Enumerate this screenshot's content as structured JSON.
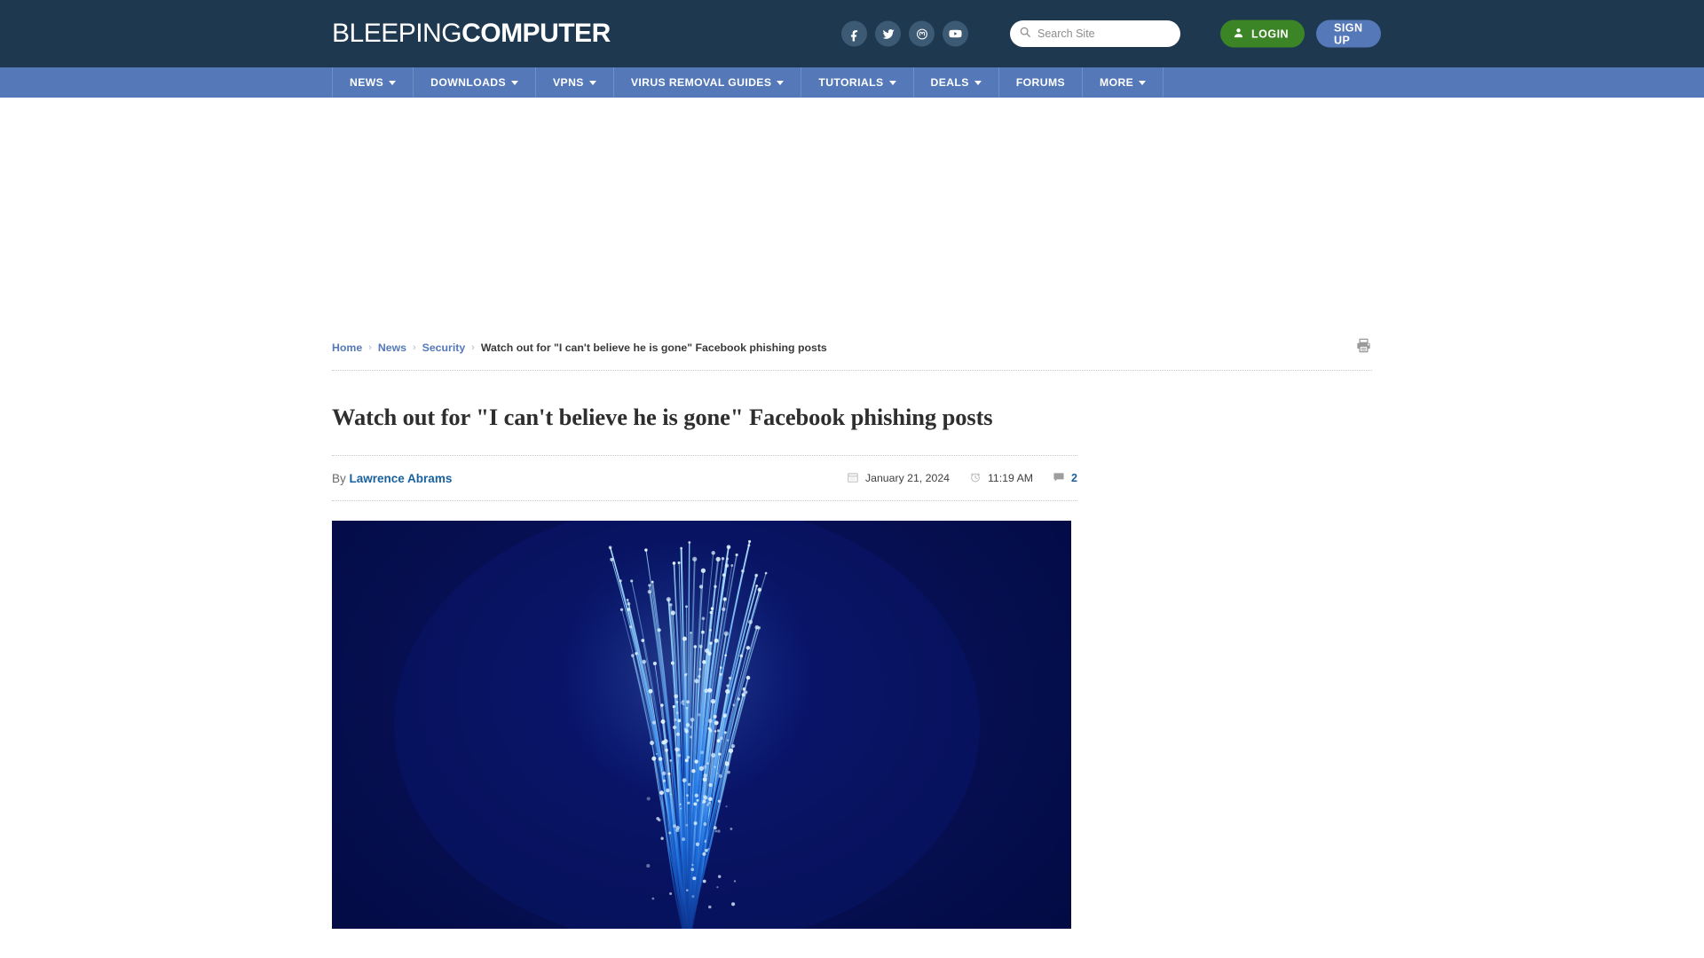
{
  "header": {
    "logo_light": "BLEEPING",
    "logo_bold": "COMPUTER",
    "social": [
      {
        "name": "facebook-icon",
        "label": "Facebook"
      },
      {
        "name": "twitter-icon",
        "label": "Twitter"
      },
      {
        "name": "mastodon-icon",
        "label": "Mastodon"
      },
      {
        "name": "youtube-icon",
        "label": "YouTube"
      }
    ],
    "search": {
      "placeholder": "Search Site",
      "value": "",
      "icon": "search-icon"
    },
    "login_label": "LOGIN",
    "signup_label": "SIGN UP",
    "colors": {
      "header_bg": "#1e3850",
      "nav_bg": "#5478b8",
      "login_green": "#3c8527",
      "signup_blue": "#5478b8",
      "link_blue": "#19619e"
    }
  },
  "nav": {
    "items": [
      {
        "label": "NEWS",
        "has_caret": true
      },
      {
        "label": "DOWNLOADS",
        "has_caret": true
      },
      {
        "label": "VPNS",
        "has_caret": true
      },
      {
        "label": "VIRUS REMOVAL GUIDES",
        "has_caret": true
      },
      {
        "label": "TUTORIALS",
        "has_caret": true
      },
      {
        "label": "DEALS",
        "has_caret": true
      },
      {
        "label": "FORUMS",
        "has_caret": false
      },
      {
        "label": "MORE",
        "has_caret": true
      }
    ]
  },
  "breadcrumb": {
    "items": [
      {
        "label": "Home",
        "is_link": true
      },
      {
        "label": "News",
        "is_link": true
      },
      {
        "label": "Security",
        "is_link": true
      },
      {
        "label": "Watch out for \"I can't believe he is gone\" Facebook phishing posts",
        "is_link": false
      }
    ],
    "separator": "›",
    "print_icon": "printer-icon"
  },
  "article": {
    "title": "Watch out for \"I can't believe he is gone\" Facebook phishing posts",
    "byline_prefix": "By",
    "author": "Lawrence Abrams",
    "date": "January 21, 2024",
    "date_icon": "calendar-icon",
    "time": "11:19 AM",
    "time_icon": "alarm-clock-icon",
    "comment_count": "2",
    "comment_icon": "comment-bubble-icon",
    "hero_image_alt": "Glowing blue fiber optic cable strands on dark navy background"
  }
}
